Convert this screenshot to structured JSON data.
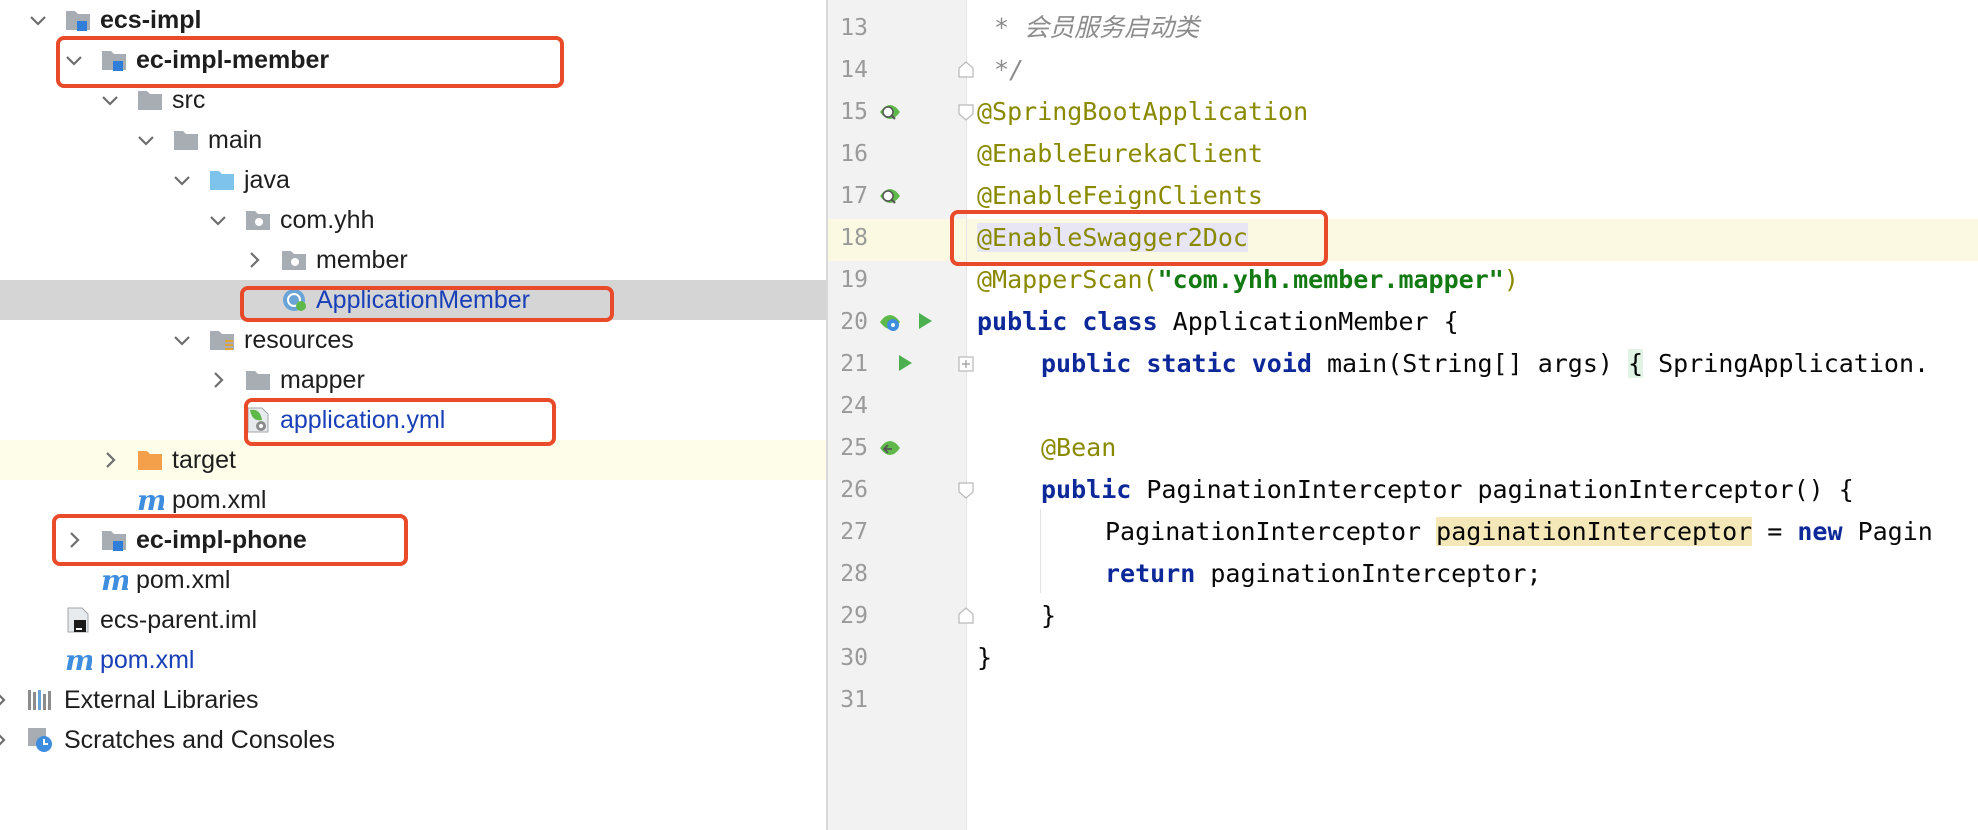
{
  "project_tree": {
    "items": [
      {
        "label": "ecs-impl",
        "icon": "module-folder-icon",
        "expanded": true,
        "bold": true
      },
      {
        "label": "ec-impl-member",
        "icon": "module-folder-icon",
        "expanded": true,
        "bold": true
      },
      {
        "label": "src",
        "icon": "folder-icon",
        "expanded": true
      },
      {
        "label": "main",
        "icon": "folder-icon",
        "expanded": true
      },
      {
        "label": "java",
        "icon": "source-root-folder-icon",
        "expanded": true
      },
      {
        "label": "com.yhh",
        "icon": "package-folder-icon",
        "expanded": true
      },
      {
        "label": "member",
        "icon": "package-folder-icon",
        "expanded": false
      },
      {
        "label": "ApplicationMember",
        "icon": "spring-boot-class-icon",
        "selected": true
      },
      {
        "label": "resources",
        "icon": "resources-folder-icon",
        "expanded": true
      },
      {
        "label": "mapper",
        "icon": "folder-icon",
        "expanded": false
      },
      {
        "label": "application.yml",
        "icon": "spring-config-file-icon"
      },
      {
        "label": "target",
        "icon": "excluded-folder-icon",
        "expanded": false
      },
      {
        "label": "pom.xml",
        "icon": "maven-file-icon"
      },
      {
        "label": "ec-impl-phone",
        "icon": "module-folder-icon",
        "expanded": false,
        "bold": true
      },
      {
        "label": "pom.xml",
        "icon": "maven-file-icon"
      },
      {
        "label": "ecs-parent.iml",
        "icon": "iml-file-icon"
      },
      {
        "label": "pom.xml",
        "icon": "maven-file-icon"
      },
      {
        "label": "External Libraries",
        "icon": "libraries-icon",
        "expanded": false
      },
      {
        "label": "Scratches and Consoles",
        "icon": "scratches-icon",
        "expanded": false
      }
    ]
  },
  "editor": {
    "line_numbers": [
      "13",
      "14",
      "15",
      "16",
      "17",
      "18",
      "19",
      "20",
      "21",
      "24",
      "25",
      "26",
      "27",
      "28",
      "29",
      "30",
      "31"
    ],
    "code": {
      "l13": "* 会员服务启动类",
      "l14": "*/",
      "l15": "@SpringBootApplication",
      "l16": "@EnableEurekaClient",
      "l17": "@EnableFeignClients",
      "l18": "@EnableSwagger2Doc",
      "l19_ann": "@MapperScan(",
      "l19_str": "\"com.yhh.member.mapper\"",
      "l19_end": ")",
      "l20_kw": "public class",
      "l20_rest": " ApplicationMember {",
      "l21_kw": "public static void",
      "l21_rest": " main(String[] args) ",
      "l21_brace": "{",
      "l21_tail": " SpringApplication.",
      "l25": "@Bean",
      "l26_kw": "public",
      "l26_rest": " PaginationInterceptor paginationInterceptor() {",
      "l27_type": "PaginationInterceptor ",
      "l27_var": "paginationInterceptor",
      "l27_eq": " = ",
      "l27_new": "new",
      "l27_tail": " Pagin",
      "l28_kw": "return",
      "l28_rest": " paginationInterceptor;",
      "l29": "}",
      "l30": "}"
    }
  },
  "colors": {
    "highlight_border": "#e84a2a",
    "keyword": "#0c2899",
    "annotation": "#8a8a00",
    "string": "#137a13",
    "current_line": "#fcf9e3"
  }
}
